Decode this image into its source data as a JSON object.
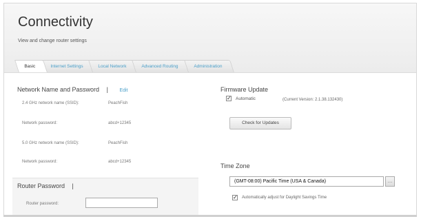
{
  "page": {
    "title": "Connectivity",
    "subtitle": "View and change router settings",
    "close_glyph": "⊗"
  },
  "tabs": [
    {
      "label": "Basic",
      "active": true
    },
    {
      "label": "Internet Settings",
      "active": false
    },
    {
      "label": "Local Network",
      "active": false
    },
    {
      "label": "Advanced Routing",
      "active": false
    },
    {
      "label": "Administration",
      "active": false
    }
  ],
  "network": {
    "title": "Network Name and Password",
    "separator": "|",
    "edit_label": "Edit",
    "rows": [
      {
        "label": "2.4 GHz network name (SSID):",
        "value": "PeachFish"
      },
      {
        "label": "Network password:",
        "value": "abcd+12345"
      },
      {
        "label": "5.0 GHz network name (SSID):",
        "value": "PeachFish"
      },
      {
        "label": "Network password:",
        "value": "abcd+12345"
      }
    ]
  },
  "router_password": {
    "title": "Router Password",
    "separator": "|",
    "field_label": "Router password:",
    "value": ""
  },
  "firmware": {
    "title": "Firmware Update",
    "automatic_label": "Automatic",
    "automatic_checked": true,
    "current_version": "(Current Version: 2.1.38.132430)",
    "check_button": "Check for Updates"
  },
  "timezone": {
    "title": "Time Zone",
    "selected": "(GMT-08:00) Pacific Time (USA & Canada)",
    "dst_label": "Automatically adjust for Daylight Savings Time",
    "dst_checked": true
  },
  "icons": {
    "checkmark": "✓",
    "dropdown": "…"
  }
}
